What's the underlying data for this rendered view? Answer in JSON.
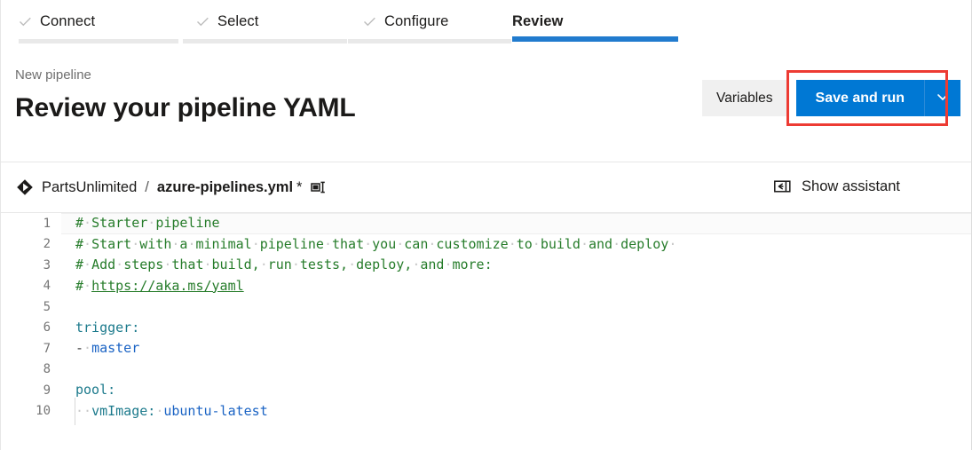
{
  "wizard": {
    "steps": [
      {
        "label": "Connect",
        "state": "completed",
        "icon": "check-icon"
      },
      {
        "label": "Select",
        "state": "completed",
        "icon": "check-icon"
      },
      {
        "label": "Configure",
        "state": "completed",
        "icon": "check-icon"
      },
      {
        "label": "Review",
        "state": "active",
        "icon": ""
      }
    ]
  },
  "header": {
    "breadcrumb": "New pipeline",
    "title": "Review your pipeline YAML",
    "variables_label": "Variables",
    "save_and_run_label": "Save and run",
    "caret_icon": "chevron-down-icon",
    "accent_color": "#0078d4",
    "highlight_color": "#ed3b33"
  },
  "filebar": {
    "repo_icon": "azure-repos-icon",
    "repo_name": "PartsUnlimited",
    "separator": "/",
    "file_name": "azure-pipelines.yml",
    "dirty_marker": "*",
    "rename_icon": "rename-icon",
    "assistant_icon": "panel-open-icon",
    "assistant_label": "Show assistant"
  },
  "editor": {
    "language": "yaml",
    "current_line": 1,
    "lines": [
      {
        "number": "1",
        "tokens": [
          {
            "t": "#",
            "c": "tk-comment"
          },
          {
            "t": "·",
            "c": "ws"
          },
          {
            "t": "Starter",
            "c": "tk-comment"
          },
          {
            "t": "·",
            "c": "ws"
          },
          {
            "t": "pipeline",
            "c": "tk-comment"
          }
        ]
      },
      {
        "number": "2",
        "tokens": [
          {
            "t": "#",
            "c": "tk-comment"
          },
          {
            "t": "·",
            "c": "ws"
          },
          {
            "t": "Start",
            "c": "tk-comment"
          },
          {
            "t": "·",
            "c": "ws"
          },
          {
            "t": "with",
            "c": "tk-comment"
          },
          {
            "t": "·",
            "c": "ws"
          },
          {
            "t": "a",
            "c": "tk-comment"
          },
          {
            "t": "·",
            "c": "ws"
          },
          {
            "t": "minimal",
            "c": "tk-comment"
          },
          {
            "t": "·",
            "c": "ws"
          },
          {
            "t": "pipeline",
            "c": "tk-comment"
          },
          {
            "t": "·",
            "c": "ws"
          },
          {
            "t": "that",
            "c": "tk-comment"
          },
          {
            "t": "·",
            "c": "ws"
          },
          {
            "t": "you",
            "c": "tk-comment"
          },
          {
            "t": "·",
            "c": "ws"
          },
          {
            "t": "can",
            "c": "tk-comment"
          },
          {
            "t": "·",
            "c": "ws"
          },
          {
            "t": "customize",
            "c": "tk-comment"
          },
          {
            "t": "·",
            "c": "ws"
          },
          {
            "t": "to",
            "c": "tk-comment"
          },
          {
            "t": "·",
            "c": "ws"
          },
          {
            "t": "build",
            "c": "tk-comment"
          },
          {
            "t": "·",
            "c": "ws"
          },
          {
            "t": "and",
            "c": "tk-comment"
          },
          {
            "t": "·",
            "c": "ws"
          },
          {
            "t": "deploy",
            "c": "tk-comment"
          },
          {
            "t": "·",
            "c": "ws"
          }
        ]
      },
      {
        "number": "3",
        "tokens": [
          {
            "t": "#",
            "c": "tk-comment"
          },
          {
            "t": "·",
            "c": "ws"
          },
          {
            "t": "Add",
            "c": "tk-comment"
          },
          {
            "t": "·",
            "c": "ws"
          },
          {
            "t": "steps",
            "c": "tk-comment"
          },
          {
            "t": "·",
            "c": "ws"
          },
          {
            "t": "that",
            "c": "tk-comment"
          },
          {
            "t": "·",
            "c": "ws"
          },
          {
            "t": "build,",
            "c": "tk-comment"
          },
          {
            "t": "·",
            "c": "ws"
          },
          {
            "t": "run",
            "c": "tk-comment"
          },
          {
            "t": "·",
            "c": "ws"
          },
          {
            "t": "tests,",
            "c": "tk-comment"
          },
          {
            "t": "·",
            "c": "ws"
          },
          {
            "t": "deploy,",
            "c": "tk-comment"
          },
          {
            "t": "·",
            "c": "ws"
          },
          {
            "t": "and",
            "c": "tk-comment"
          },
          {
            "t": "·",
            "c": "ws"
          },
          {
            "t": "more:",
            "c": "tk-comment"
          }
        ]
      },
      {
        "number": "4",
        "tokens": [
          {
            "t": "#",
            "c": "tk-comment"
          },
          {
            "t": "·",
            "c": "ws"
          },
          {
            "t": "https://aka.ms/yaml",
            "c": "tk-link"
          }
        ]
      },
      {
        "number": "5",
        "tokens": []
      },
      {
        "number": "6",
        "tokens": [
          {
            "t": "trigger",
            "c": "tk-key"
          },
          {
            "t": ":",
            "c": "tk-punct"
          }
        ]
      },
      {
        "number": "7",
        "tokens": [
          {
            "t": "-",
            "c": "tk-dash"
          },
          {
            "t": "·",
            "c": "ws"
          },
          {
            "t": "master",
            "c": "tk-value"
          }
        ]
      },
      {
        "number": "8",
        "tokens": []
      },
      {
        "number": "9",
        "tokens": [
          {
            "t": "pool",
            "c": "tk-key"
          },
          {
            "t": ":",
            "c": "tk-punct"
          }
        ]
      },
      {
        "number": "10",
        "tokens": [
          {
            "t": "·",
            "c": "ws indent-guide"
          },
          {
            "t": "·",
            "c": "ws"
          },
          {
            "t": "vmImage",
            "c": "tk-key"
          },
          {
            "t": ":",
            "c": "tk-punct"
          },
          {
            "t": "·",
            "c": "ws"
          },
          {
            "t": "ubuntu-latest",
            "c": "tk-value"
          }
        ]
      }
    ]
  }
}
